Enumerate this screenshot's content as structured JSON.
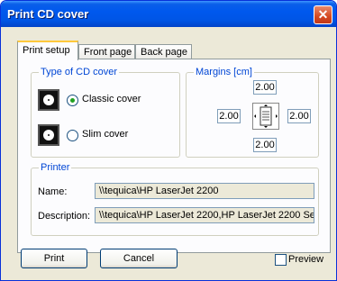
{
  "window": {
    "title": "Print CD cover",
    "close_glyph": "✕"
  },
  "tabs": [
    {
      "label": "Print setup",
      "active": true
    },
    {
      "label": "Front page",
      "active": false
    },
    {
      "label": "Back page",
      "active": false
    }
  ],
  "cd_type": {
    "label": "Type of CD cover",
    "options": [
      {
        "label": "Classic cover",
        "selected": true,
        "icon": "cd-classic-icon"
      },
      {
        "label": "Slim cover",
        "selected": false,
        "icon": "cd-slim-icon"
      }
    ]
  },
  "margins": {
    "label": "Margins [cm]",
    "top": "2.00",
    "left": "2.00",
    "right": "2.00",
    "bottom": "2.00",
    "icon": "margins-page-icon"
  },
  "printer": {
    "label": "Printer",
    "name_label": "Name:",
    "name_value": "\\\\tequica\\HP LaserJet 2200",
    "description_label": "Description:",
    "description_value": "\\\\tequica\\HP LaserJet 2200,HP LaserJet 2200 Se"
  },
  "buttons": {
    "print": "Print",
    "cancel": "Cancel"
  },
  "preview": {
    "label": "Preview",
    "checked": false
  },
  "colors": {
    "title_bar": "#0058ee",
    "group_label": "#0046d5",
    "radio_selected": "#21a121",
    "close_button": "#d6491f"
  }
}
